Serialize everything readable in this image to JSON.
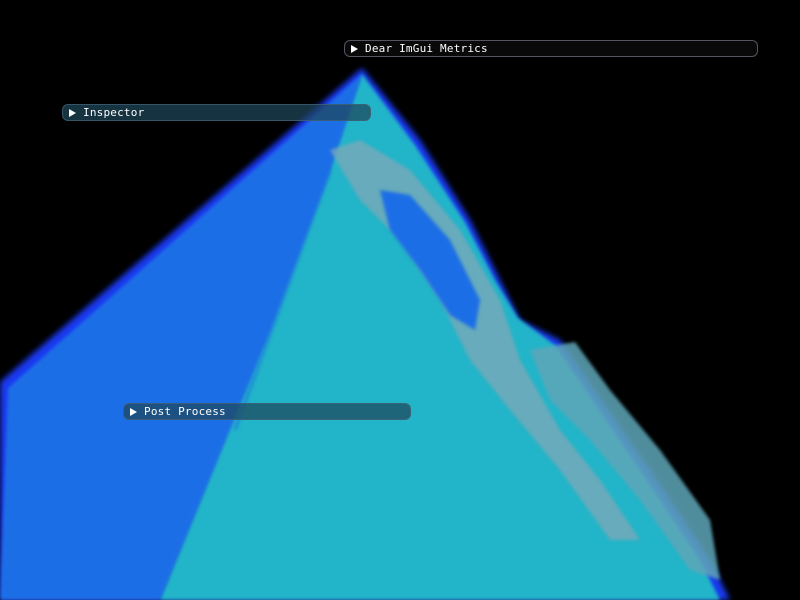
{
  "windows": [
    {
      "id": "metrics",
      "title": "Dear ImGui Metrics",
      "collapsed": true
    },
    {
      "id": "inspector",
      "title": "Inspector",
      "collapsed": true
    },
    {
      "id": "postprocess",
      "title": "Post Process",
      "collapsed": true
    }
  ],
  "scene": {
    "background": "#000000",
    "colors": {
      "edge_blue": "#1a3cff",
      "face_blue": "#1c6ee6",
      "face_cyan": "#22b4c8",
      "highlight": "#7fa8b8"
    }
  },
  "icons": {
    "collapse": "collapse-arrow-icon"
  }
}
